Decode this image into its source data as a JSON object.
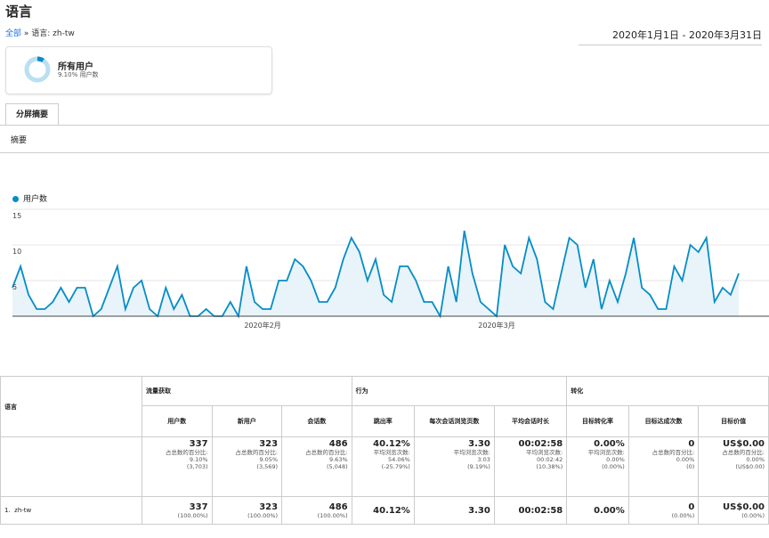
{
  "header": {
    "title": "语言"
  },
  "breadcrumb": {
    "root": "全部",
    "separator": "»",
    "current": "语言: zh-tw"
  },
  "date_range": "2020年1月1日 - 2020年3月31日",
  "segment": {
    "name": "所有用户",
    "subtitle": "9.10% 用户数",
    "fraction": 0.091
  },
  "tabs": {
    "active": "分屏摘要",
    "sub": "摘要"
  },
  "chart_data": {
    "type": "area",
    "legend": "用户数",
    "y_ticks": [
      "15",
      "10",
      "5"
    ],
    "ylim": [
      0,
      15
    ],
    "x_tick_labels": [
      {
        "label": "2020年2月",
        "index": 31
      },
      {
        "label": "2020年3月",
        "index": 60
      }
    ],
    "color": "#058dc7",
    "x": [
      "2020-01-01",
      "2020-03-31"
    ],
    "values": [
      4,
      7,
      3,
      1,
      1,
      2,
      4,
      2,
      4,
      4,
      0,
      1,
      4,
      7,
      1,
      4,
      5,
      1,
      0,
      4,
      1,
      3,
      0,
      0,
      1,
      0,
      0,
      2,
      0,
      7,
      2,
      1,
      1,
      5,
      5,
      8,
      7,
      5,
      2,
      2,
      4,
      8,
      11,
      9,
      5,
      8,
      3,
      2,
      7,
      7,
      5,
      2,
      2,
      0,
      7,
      2,
      12,
      6,
      2,
      1,
      0,
      10,
      7,
      6,
      11,
      8,
      2,
      1,
      6,
      11,
      10,
      4,
      8,
      1,
      5,
      2,
      6,
      11,
      4,
      3,
      1,
      1,
      7,
      5,
      10,
      9,
      11,
      2,
      4,
      3,
      6
    ]
  },
  "table": {
    "dimension_header": "语言",
    "groups": [
      "流量获取",
      "行为",
      "转化"
    ],
    "columns": [
      "用户数",
      "新用户",
      "会话数",
      "跳出率",
      "每次会话浏览页数",
      "平均会话时长",
      "目标转化率",
      "目标达成次数",
      "目标价值"
    ],
    "totals": [
      {
        "main": "337",
        "lines": [
          "占总数的百分比:",
          "9.10%",
          "(3,703)"
        ]
      },
      {
        "main": "323",
        "lines": [
          "占总数的百分比:",
          "9.05%",
          "(3,569)"
        ]
      },
      {
        "main": "486",
        "lines": [
          "占总数的百分比:",
          "9.63%",
          "(5,048)"
        ]
      },
      {
        "main": "40.12%",
        "lines": [
          "平均浏览次数:",
          "54.06%",
          "(-25.79%)"
        ]
      },
      {
        "main": "3.30",
        "lines": [
          "平均浏览次数:",
          "3.03",
          "(9.19%)"
        ]
      },
      {
        "main": "00:02:58",
        "lines": [
          "平均浏览次数:",
          "00:02:42",
          "(10.38%)"
        ]
      },
      {
        "main": "0.00%",
        "lines": [
          "平均浏览次数:",
          "0.00%",
          "(0.00%)"
        ]
      },
      {
        "main": "0",
        "lines": [
          "占总数的百分比:",
          "0.00%",
          "(0)"
        ]
      },
      {
        "main": "US$0.00",
        "lines": [
          "占总数的百分比:",
          "0.00%",
          "(US$0.00)"
        ]
      }
    ],
    "row": {
      "index": "1.",
      "label": "zh-tw",
      "cells": [
        {
          "main": "337",
          "pct": "(100.00%)"
        },
        {
          "main": "323",
          "pct": "(100.00%)"
        },
        {
          "main": "486",
          "pct": "(100.00%)"
        },
        {
          "main": "40.12%",
          "pct": ""
        },
        {
          "main": "3.30",
          "pct": ""
        },
        {
          "main": "00:02:58",
          "pct": ""
        },
        {
          "main": "0.00%",
          "pct": ""
        },
        {
          "main": "0",
          "pct": "(0.00%)"
        },
        {
          "main": "US$0.00",
          "pct": "(0.00%)"
        }
      ]
    }
  }
}
